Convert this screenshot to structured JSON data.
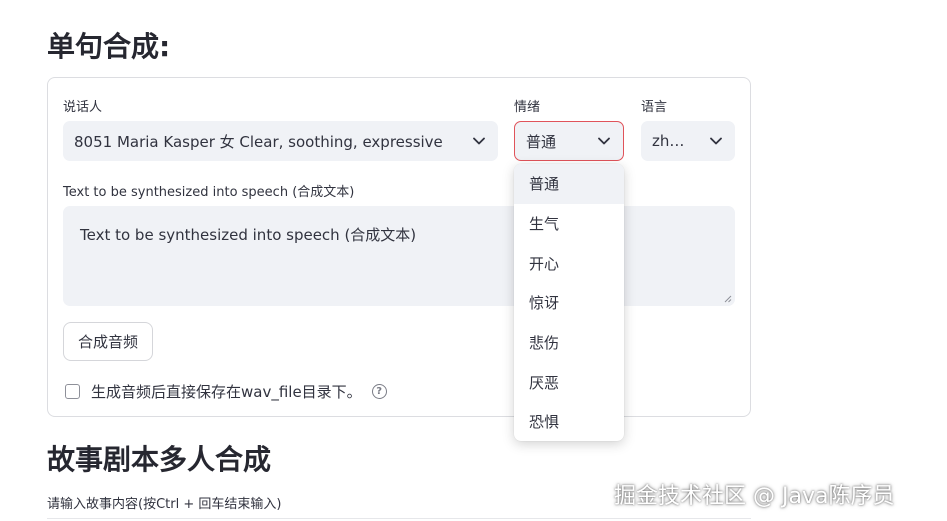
{
  "section_single": {
    "title": "单句合成:",
    "speaker_label": "说话人",
    "speaker_value": "8051 Maria Kasper 女 Clear, soothing, expressive",
    "emotion_label": "情绪",
    "emotion_value": "普通",
    "language_label": "语言",
    "language_value": "zh…",
    "text_label": "Text to be synthesized into speech (合成文本)",
    "text_value": "Text to be synthesized into speech (合成文本)",
    "synth_button": "合成音频",
    "save_checkbox_label": "生成音频后直接保存在wav_file目录下。",
    "help_icon_glyph": "?"
  },
  "emotion_dropdown": {
    "options": [
      "普通",
      "生气",
      "开心",
      "惊讶",
      "悲伤",
      "厌恶",
      "恐惧"
    ],
    "selected_index": 0
  },
  "section_story": {
    "title": "故事剧本多人合成",
    "input_label": "请输入故事内容(按Ctrl + 回车结束输入)"
  },
  "watermark": "掘金技术社区 @ Java陈序员",
  "colors": {
    "focus_border": "#e0535a",
    "input_bg": "#f0f2f6",
    "text": "#31333f"
  }
}
